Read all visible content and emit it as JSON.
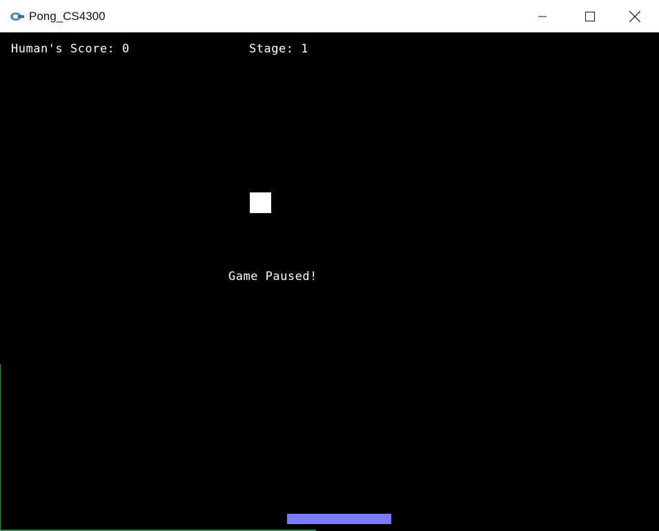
{
  "window": {
    "title": "Pong_CS4300",
    "minimize_icon": "minimize-icon",
    "maximize_icon": "maximize-icon",
    "close_icon": "close-icon"
  },
  "hud": {
    "score_text": "Human's Score: 0",
    "stage_text": "Stage: 1"
  },
  "game": {
    "status_text": "Game Paused!",
    "ball_color": "#ffffff",
    "paddle_color": "#7b7bff",
    "background_color": "#000000"
  }
}
